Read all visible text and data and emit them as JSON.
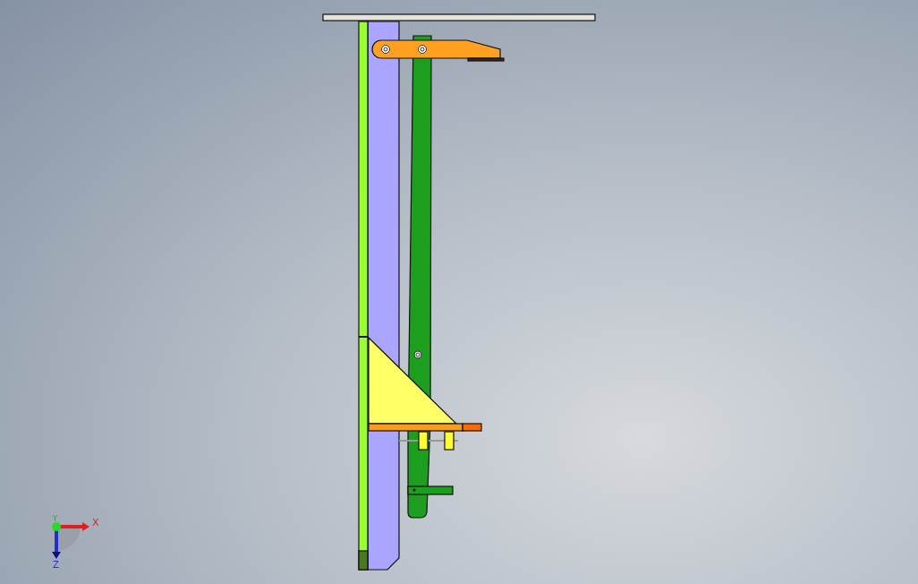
{
  "triad": {
    "x_label": "X",
    "y_label": "Y",
    "z_label": "Z"
  }
}
